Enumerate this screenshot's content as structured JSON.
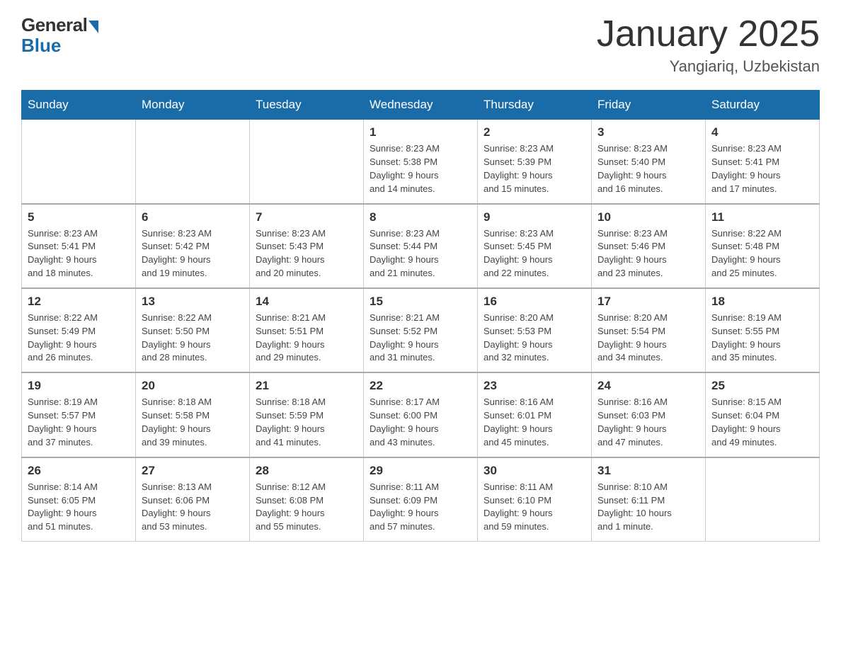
{
  "logo": {
    "general": "General",
    "blue": "Blue"
  },
  "title": "January 2025",
  "location": "Yangiariq, Uzbekistan",
  "days_of_week": [
    "Sunday",
    "Monday",
    "Tuesday",
    "Wednesday",
    "Thursday",
    "Friday",
    "Saturday"
  ],
  "weeks": [
    [
      {
        "day": "",
        "info": ""
      },
      {
        "day": "",
        "info": ""
      },
      {
        "day": "",
        "info": ""
      },
      {
        "day": "1",
        "info": "Sunrise: 8:23 AM\nSunset: 5:38 PM\nDaylight: 9 hours\nand 14 minutes."
      },
      {
        "day": "2",
        "info": "Sunrise: 8:23 AM\nSunset: 5:39 PM\nDaylight: 9 hours\nand 15 minutes."
      },
      {
        "day": "3",
        "info": "Sunrise: 8:23 AM\nSunset: 5:40 PM\nDaylight: 9 hours\nand 16 minutes."
      },
      {
        "day": "4",
        "info": "Sunrise: 8:23 AM\nSunset: 5:41 PM\nDaylight: 9 hours\nand 17 minutes."
      }
    ],
    [
      {
        "day": "5",
        "info": "Sunrise: 8:23 AM\nSunset: 5:41 PM\nDaylight: 9 hours\nand 18 minutes."
      },
      {
        "day": "6",
        "info": "Sunrise: 8:23 AM\nSunset: 5:42 PM\nDaylight: 9 hours\nand 19 minutes."
      },
      {
        "day": "7",
        "info": "Sunrise: 8:23 AM\nSunset: 5:43 PM\nDaylight: 9 hours\nand 20 minutes."
      },
      {
        "day": "8",
        "info": "Sunrise: 8:23 AM\nSunset: 5:44 PM\nDaylight: 9 hours\nand 21 minutes."
      },
      {
        "day": "9",
        "info": "Sunrise: 8:23 AM\nSunset: 5:45 PM\nDaylight: 9 hours\nand 22 minutes."
      },
      {
        "day": "10",
        "info": "Sunrise: 8:23 AM\nSunset: 5:46 PM\nDaylight: 9 hours\nand 23 minutes."
      },
      {
        "day": "11",
        "info": "Sunrise: 8:22 AM\nSunset: 5:48 PM\nDaylight: 9 hours\nand 25 minutes."
      }
    ],
    [
      {
        "day": "12",
        "info": "Sunrise: 8:22 AM\nSunset: 5:49 PM\nDaylight: 9 hours\nand 26 minutes."
      },
      {
        "day": "13",
        "info": "Sunrise: 8:22 AM\nSunset: 5:50 PM\nDaylight: 9 hours\nand 28 minutes."
      },
      {
        "day": "14",
        "info": "Sunrise: 8:21 AM\nSunset: 5:51 PM\nDaylight: 9 hours\nand 29 minutes."
      },
      {
        "day": "15",
        "info": "Sunrise: 8:21 AM\nSunset: 5:52 PM\nDaylight: 9 hours\nand 31 minutes."
      },
      {
        "day": "16",
        "info": "Sunrise: 8:20 AM\nSunset: 5:53 PM\nDaylight: 9 hours\nand 32 minutes."
      },
      {
        "day": "17",
        "info": "Sunrise: 8:20 AM\nSunset: 5:54 PM\nDaylight: 9 hours\nand 34 minutes."
      },
      {
        "day": "18",
        "info": "Sunrise: 8:19 AM\nSunset: 5:55 PM\nDaylight: 9 hours\nand 35 minutes."
      }
    ],
    [
      {
        "day": "19",
        "info": "Sunrise: 8:19 AM\nSunset: 5:57 PM\nDaylight: 9 hours\nand 37 minutes."
      },
      {
        "day": "20",
        "info": "Sunrise: 8:18 AM\nSunset: 5:58 PM\nDaylight: 9 hours\nand 39 minutes."
      },
      {
        "day": "21",
        "info": "Sunrise: 8:18 AM\nSunset: 5:59 PM\nDaylight: 9 hours\nand 41 minutes."
      },
      {
        "day": "22",
        "info": "Sunrise: 8:17 AM\nSunset: 6:00 PM\nDaylight: 9 hours\nand 43 minutes."
      },
      {
        "day": "23",
        "info": "Sunrise: 8:16 AM\nSunset: 6:01 PM\nDaylight: 9 hours\nand 45 minutes."
      },
      {
        "day": "24",
        "info": "Sunrise: 8:16 AM\nSunset: 6:03 PM\nDaylight: 9 hours\nand 47 minutes."
      },
      {
        "day": "25",
        "info": "Sunrise: 8:15 AM\nSunset: 6:04 PM\nDaylight: 9 hours\nand 49 minutes."
      }
    ],
    [
      {
        "day": "26",
        "info": "Sunrise: 8:14 AM\nSunset: 6:05 PM\nDaylight: 9 hours\nand 51 minutes."
      },
      {
        "day": "27",
        "info": "Sunrise: 8:13 AM\nSunset: 6:06 PM\nDaylight: 9 hours\nand 53 minutes."
      },
      {
        "day": "28",
        "info": "Sunrise: 8:12 AM\nSunset: 6:08 PM\nDaylight: 9 hours\nand 55 minutes."
      },
      {
        "day": "29",
        "info": "Sunrise: 8:11 AM\nSunset: 6:09 PM\nDaylight: 9 hours\nand 57 minutes."
      },
      {
        "day": "30",
        "info": "Sunrise: 8:11 AM\nSunset: 6:10 PM\nDaylight: 9 hours\nand 59 minutes."
      },
      {
        "day": "31",
        "info": "Sunrise: 8:10 AM\nSunset: 6:11 PM\nDaylight: 10 hours\nand 1 minute."
      },
      {
        "day": "",
        "info": ""
      }
    ]
  ]
}
